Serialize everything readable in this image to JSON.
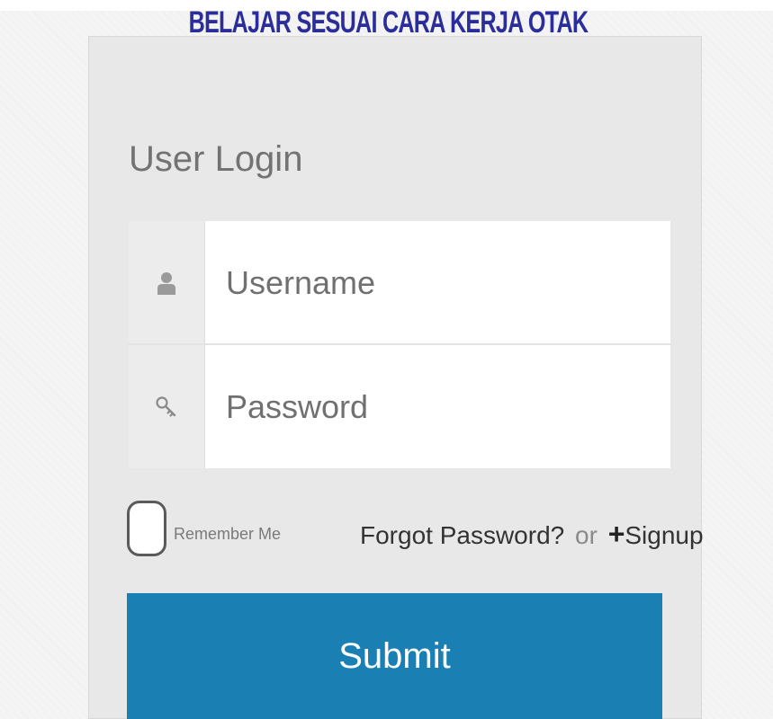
{
  "banner": {
    "text": "BELAJAR SESUAI CARA KERJA OTAK"
  },
  "login": {
    "title": "User Login",
    "username": {
      "placeholder": "Username",
      "value": "",
      "icon": "user-icon"
    },
    "password": {
      "placeholder": "Password",
      "value": "",
      "icon": "key-icon"
    },
    "remember_label": "Remember Me",
    "remember_checked": false,
    "forgot_label": "Forgot Password?",
    "or_label": "or",
    "signup_label": "Signup",
    "submit_label": "Submit"
  },
  "colors": {
    "banner_text": "#2b2e9a",
    "panel_bg": "#e8e8e8",
    "submit_bg": "#1a80b3",
    "title_text": "#737373"
  }
}
